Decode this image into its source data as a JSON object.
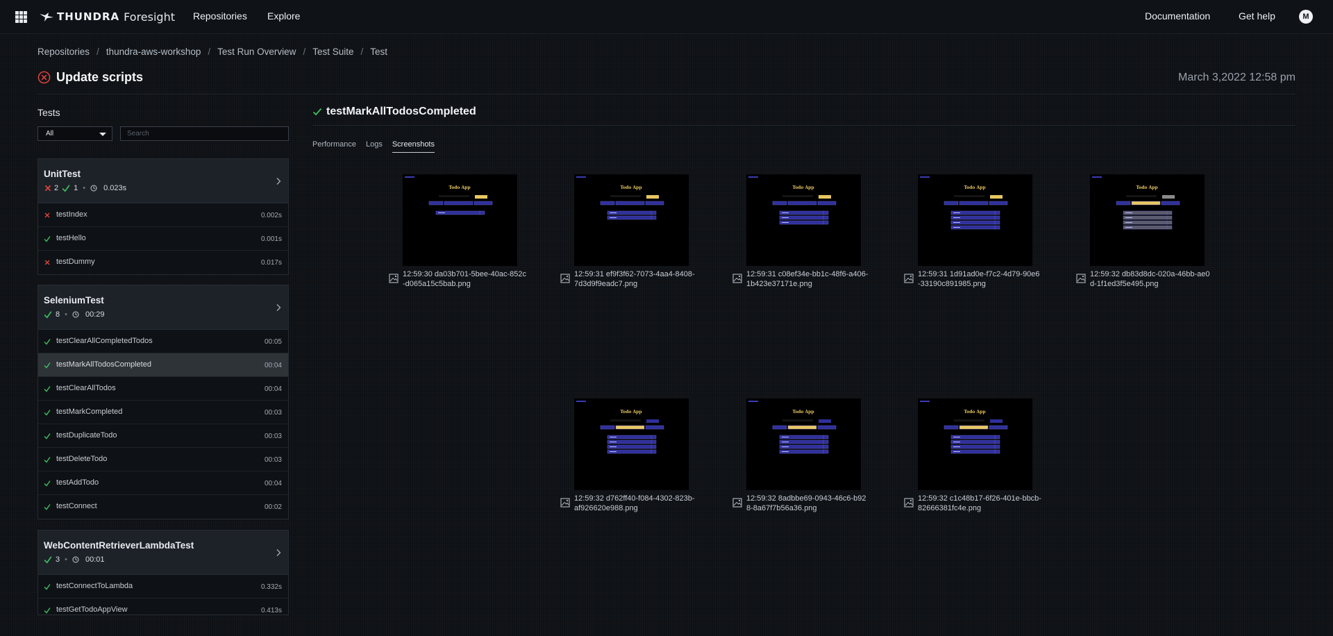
{
  "topbar": {
    "brand": "THUNDRA",
    "product": "Foresight",
    "nav": [
      "Repositories",
      "Explore"
    ],
    "right_links": [
      "Documentation",
      "Get help"
    ],
    "avatar_initial": "M"
  },
  "breadcrumb": [
    "Repositories",
    "thundra-aws-workshop",
    "Test Run Overview",
    "Test Suite",
    "Test"
  ],
  "run": {
    "title": "Update scripts",
    "status": "failed",
    "date": "March 3,2022 12:58 pm"
  },
  "sidebar": {
    "heading": "Tests",
    "filter_value": "All",
    "search_placeholder": "Search",
    "suites": [
      {
        "name": "UnitTest",
        "failed": "2",
        "passed": "1",
        "duration": "0.023s",
        "tests": [
          {
            "name": "testIndex",
            "status": "failed",
            "duration": "0.002s"
          },
          {
            "name": "testHello",
            "status": "passed",
            "duration": "0.001s"
          },
          {
            "name": "testDummy",
            "status": "failed",
            "duration": "0.017s"
          }
        ]
      },
      {
        "name": "SeleniumTest",
        "passed": "8",
        "duration": "00:29",
        "tests": [
          {
            "name": "testClearAllCompletedTodos",
            "status": "passed",
            "duration": "00:05"
          },
          {
            "name": "testMarkAllTodosCompleted",
            "status": "passed",
            "duration": "00:04",
            "selected": true
          },
          {
            "name": "testClearAllTodos",
            "status": "passed",
            "duration": "00:04"
          },
          {
            "name": "testMarkCompleted",
            "status": "passed",
            "duration": "00:03"
          },
          {
            "name": "testDuplicateTodo",
            "status": "passed",
            "duration": "00:03"
          },
          {
            "name": "testDeleteTodo",
            "status": "passed",
            "duration": "00:03"
          },
          {
            "name": "testAddTodo",
            "status": "passed",
            "duration": "00:04"
          },
          {
            "name": "testConnect",
            "status": "passed",
            "duration": "00:02"
          }
        ]
      },
      {
        "name": "WebContentRetrieverLambdaTest",
        "passed": "3",
        "duration": "00:01",
        "tests": [
          {
            "name": "testConnectToLambda",
            "status": "passed",
            "duration": "0.332s"
          },
          {
            "name": "testGetTodoAppView",
            "status": "passed",
            "duration": "0.413s"
          }
        ]
      }
    ]
  },
  "detail": {
    "test_name": "testMarkAllTodosCompleted",
    "tabs": [
      "Performance",
      "Logs",
      "Screenshots"
    ],
    "active_tab": "Screenshots",
    "screenshots": [
      {
        "caption": "12:59:30 da03b701-5bee-40ac-852c-d065a15c5bab.png",
        "rows": 1,
        "filter_highlight": "none",
        "add_highlight": true,
        "added_field": false
      },
      {
        "caption": "12:59:31 ef9f3f62-7073-4aa4-8408-7d3d9f9eadc7.png",
        "rows": 2,
        "filter_highlight": "none",
        "add_highlight": true,
        "added_field": false
      },
      {
        "caption": "12:59:31 c08ef34e-bb1c-48f6-a406-1b423e37171e.png",
        "rows": 3,
        "filter_highlight": "none",
        "add_highlight": true,
        "added_field": false
      },
      {
        "caption": "12:59:31 1d91ad0e-f7c2-4d79-90e6-33190c891985.png",
        "rows": 4,
        "filter_highlight": "none",
        "add_highlight": true,
        "added_field": false
      },
      {
        "caption": "12:59:32 db83d8dc-020a-46bb-ae0d-1f1ed3f5e495.png",
        "rows": 4,
        "filter_highlight": "completed",
        "add_highlight": false,
        "added_field": false
      },
      {
        "caption": "12:59:32 d762ff40-f084-4302-823b-af926620e988.png",
        "rows": 4,
        "filter_highlight": "completed",
        "add_highlight": false,
        "added_field": true
      },
      {
        "caption": "12:59:32 8adbbe69-0943-46c6-b928-8a67f7b56a36.png",
        "rows": 4,
        "filter_highlight": "completed",
        "add_highlight": false,
        "added_field": true
      },
      {
        "caption": "12:59:32 c1c48b17-6f26-401e-bbcb-82666381fc4e.png",
        "rows": 4,
        "filter_highlight": "completed",
        "add_highlight": false,
        "added_field": true
      }
    ],
    "thumbnail_app_title": "Todo App"
  },
  "colors": {
    "pass": "#3fbf5f",
    "fail": "#e0443e",
    "accent_yellow": "#e8c760",
    "todo_row": "#2f2f9a"
  }
}
